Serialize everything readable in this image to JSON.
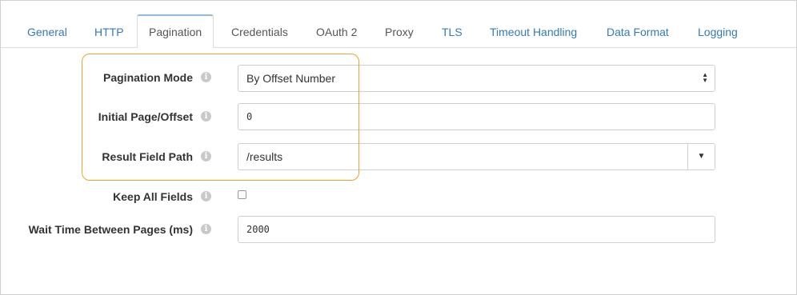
{
  "tabs": [
    {
      "label": "General"
    },
    {
      "label": "HTTP"
    },
    {
      "label": "Pagination"
    },
    {
      "label": "Credentials"
    },
    {
      "label": "OAuth 2"
    },
    {
      "label": "Proxy"
    },
    {
      "label": "TLS"
    },
    {
      "label": "Timeout Handling"
    },
    {
      "label": "Data Format"
    },
    {
      "label": "Logging"
    }
  ],
  "active_tab": "Pagination",
  "form": {
    "pagination_mode": {
      "label": "Pagination Mode",
      "value": "By Offset Number"
    },
    "initial_page": {
      "label": "Initial Page/Offset",
      "value": "0"
    },
    "result_field_path": {
      "label": "Result Field Path",
      "value": "/results"
    },
    "keep_all_fields": {
      "label": "Keep All Fields",
      "checked": false
    },
    "wait_time": {
      "label": "Wait Time Between Pages (ms)",
      "value": "2000"
    }
  },
  "colors": {
    "highlight": "#f0a033",
    "tab_link": "#337ab7",
    "active_tab_top": "#8fb9dd"
  }
}
